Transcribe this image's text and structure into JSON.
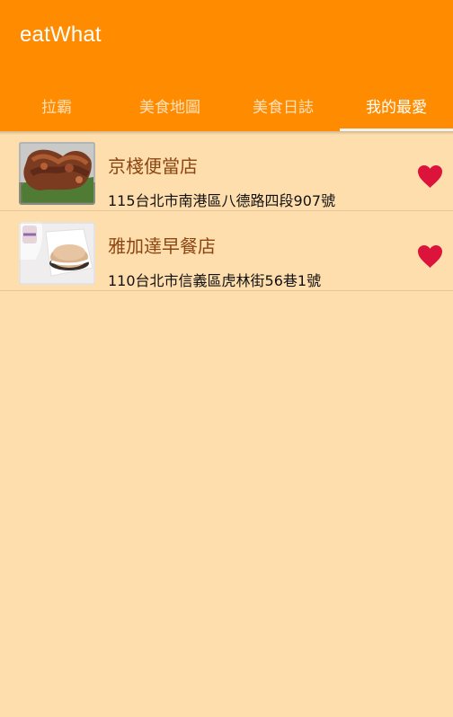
{
  "app": {
    "title": "eatWhat"
  },
  "tabs": [
    {
      "label": "拉霸"
    },
    {
      "label": "美食地圖"
    },
    {
      "label": "美食日誌"
    },
    {
      "label": "我的最愛"
    }
  ],
  "favorites": [
    {
      "name": "京棧便當店",
      "address": "115台北市南港區八德路四段907號",
      "favorite_icon": "heart-icon"
    },
    {
      "name": "雅加達早餐店",
      "address": "110台北市信義區虎林街56巷1號",
      "favorite_icon": "heart-icon"
    }
  ],
  "colors": {
    "app_bar": "#ff8c00",
    "background": "#ffdead",
    "item_title": "#8b4513",
    "favorite_heart": "#dc143c"
  }
}
